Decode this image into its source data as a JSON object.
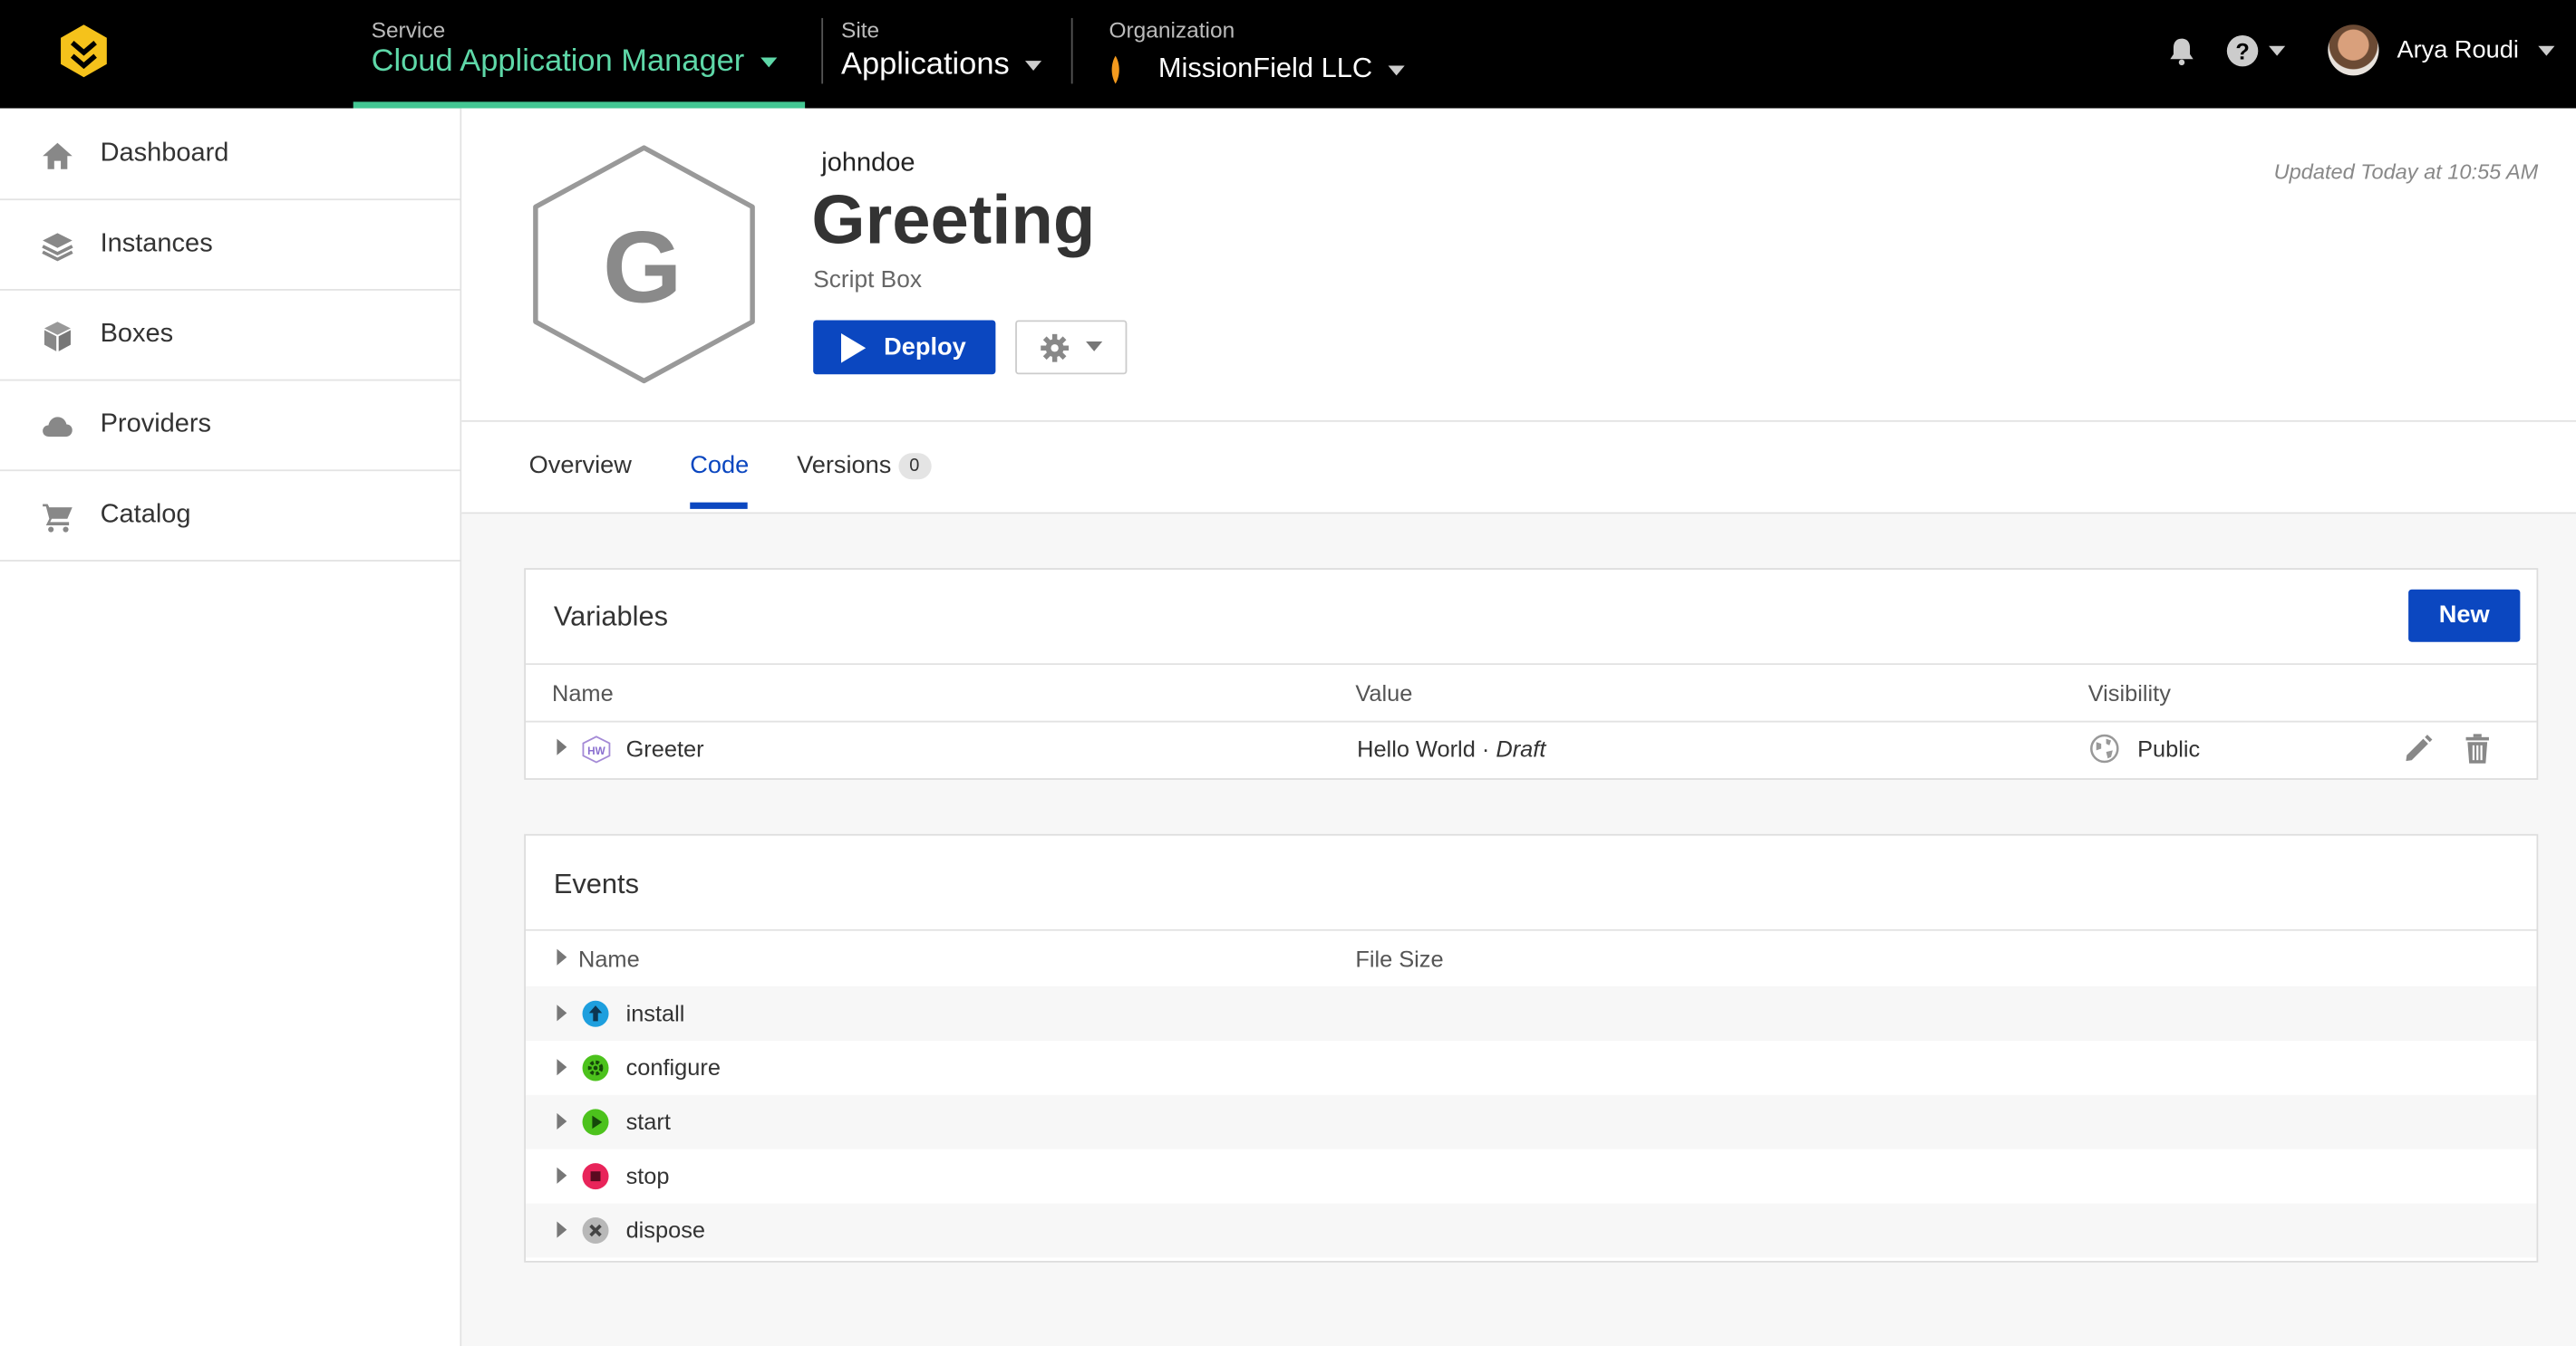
{
  "topbar": {
    "service_label": "Service",
    "service_value": "Cloud Application Manager",
    "site_label": "Site",
    "site_value": "Applications",
    "org_label": "Organization",
    "org_value": "MissionField LLC",
    "user_name": "Arya Roudi",
    "icons": [
      "bell-icon",
      "help-icon",
      "avatar"
    ]
  },
  "sidebar": {
    "items": [
      {
        "label": "Dashboard",
        "icon": "home-icon"
      },
      {
        "label": "Instances",
        "icon": "layers-icon"
      },
      {
        "label": "Boxes",
        "icon": "box-icon"
      },
      {
        "label": "Providers",
        "icon": "cloud-icon"
      },
      {
        "label": "Catalog",
        "icon": "cart-icon"
      }
    ]
  },
  "box": {
    "initial": "G",
    "owner": "johndoe",
    "title": "Greeting",
    "subtitle": "Script Box",
    "updated": "Updated Today at 10:55 AM",
    "deploy_label": "Deploy"
  },
  "tabs": {
    "overview": "Overview",
    "code": "Code",
    "versions": "Versions",
    "versions_count": "0",
    "active": "Code"
  },
  "variables": {
    "title": "Variables",
    "new_label": "New",
    "columns": {
      "name": "Name",
      "value": "Value",
      "visibility": "Visibility"
    },
    "rows": [
      {
        "badge": "HW",
        "name": "Greeter",
        "value": "Hello World",
        "separator": " · ",
        "status": "Draft",
        "visibility": "Public"
      }
    ]
  },
  "events": {
    "title": "Events",
    "columns": {
      "name": "Name",
      "file_size": "File Size"
    },
    "rows": [
      {
        "name": "install",
        "icon": "install-icon",
        "color": "#1e9fde"
      },
      {
        "name": "configure",
        "icon": "configure-icon",
        "color": "#4cc21c"
      },
      {
        "name": "start",
        "icon": "start-icon",
        "color": "#4cc21c"
      },
      {
        "name": "stop",
        "icon": "stop-icon",
        "color": "#e8245a"
      },
      {
        "name": "dispose",
        "icon": "dispose-icon",
        "color": "#b8b8b8"
      }
    ]
  },
  "colors": {
    "accent": "#0b47c0",
    "service_green": "#43c793",
    "topbar_bg": "#000000"
  }
}
